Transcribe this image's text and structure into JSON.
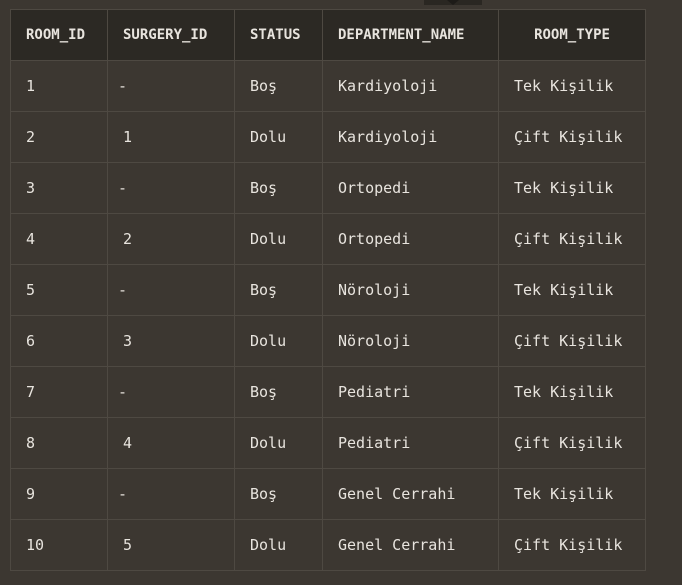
{
  "table": {
    "headers": [
      "ROOM_ID",
      "SURGERY_ID",
      "STATUS",
      "DEPARTMENT_NAME",
      "ROOM_TYPE"
    ],
    "rows": [
      [
        "1",
        "-",
        "Boş",
        "Kardiyoloji",
        "Tek Kişilik"
      ],
      [
        "2",
        "1",
        "Dolu",
        "Kardiyoloji",
        "Çift Kişilik"
      ],
      [
        "3",
        "-",
        "Boş",
        "Ortopedi",
        "Tek Kişilik"
      ],
      [
        "4",
        "2",
        "Dolu",
        "Ortopedi",
        "Çift Kişilik"
      ],
      [
        "5",
        "-",
        "Boş",
        "Nöroloji",
        "Tek Kişilik"
      ],
      [
        "6",
        "3",
        "Dolu",
        "Nöroloji",
        "Çift Kişilik"
      ],
      [
        "7",
        "-",
        "Boş",
        "Pediatri",
        "Tek Kişilik"
      ],
      [
        "8",
        "4",
        "Dolu",
        "Pediatri",
        "Çift Kişilik"
      ],
      [
        "9",
        "-",
        "Boş",
        "Genel Cerrahi",
        "Tek Kişilik"
      ],
      [
        "10",
        "5",
        "Dolu",
        "Genel Cerrahi",
        "Çift Kişilik"
      ]
    ]
  },
  "colors": {
    "background": "#3c3731",
    "header_background": "#2c2924",
    "grid_line": "#4e4942",
    "text": "#e8e4de"
  }
}
